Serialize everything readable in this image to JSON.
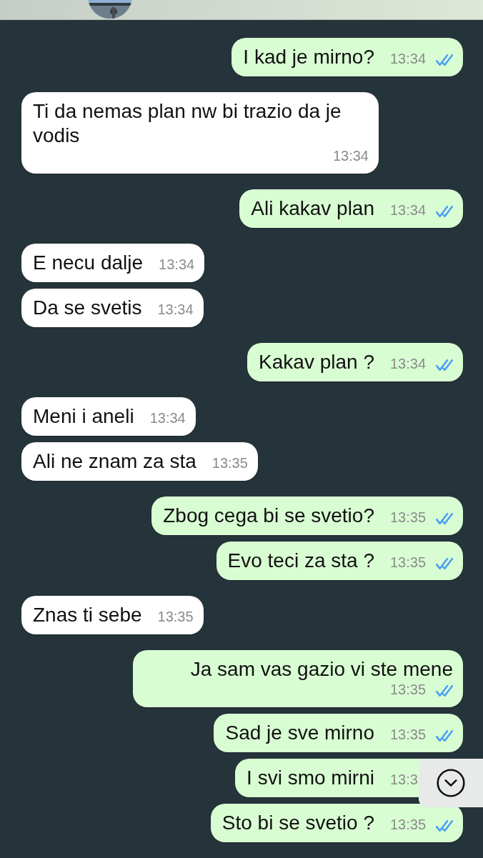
{
  "messages": [
    {
      "kind": "sent",
      "text": "I kad je mirno?",
      "time": "13:34",
      "read": true
    },
    {
      "kind": "received",
      "text": "Ti da nemas plan nw bi trazio da je vodis",
      "time": "13:34"
    },
    {
      "kind": "sent",
      "text": "Ali kakav plan",
      "time": "13:34",
      "read": true
    },
    {
      "kind": "received",
      "text": "E necu dalje",
      "time": "13:34"
    },
    {
      "kind": "received",
      "text": "Da se svetis",
      "time": "13:34"
    },
    {
      "kind": "sent",
      "text": "Kakav plan ?",
      "time": "13:34",
      "read": true
    },
    {
      "kind": "received",
      "text": "Meni i aneli",
      "time": "13:34"
    },
    {
      "kind": "received",
      "text": "Ali ne znam za sta",
      "time": "13:35"
    },
    {
      "kind": "sent",
      "text": "Zbog cega bi se svetio?",
      "time": "13:35",
      "read": true
    },
    {
      "kind": "sent",
      "text": "Evo teci za sta ?",
      "time": "13:35",
      "read": true
    },
    {
      "kind": "received",
      "text": "Znas ti sebe",
      "time": "13:35"
    },
    {
      "kind": "sent",
      "text": "Ja sam vas gazio vi ste mene",
      "time": "13:35",
      "read": true
    },
    {
      "kind": "sent",
      "text": "Sad je sve mirno",
      "time": "13:35",
      "read": true
    },
    {
      "kind": "sent",
      "text": "I svi smo mirni",
      "time": "13:3"
    },
    {
      "kind": "sent",
      "text": "Sto bi se svetio ?",
      "time": "13:35",
      "read": true
    }
  ]
}
